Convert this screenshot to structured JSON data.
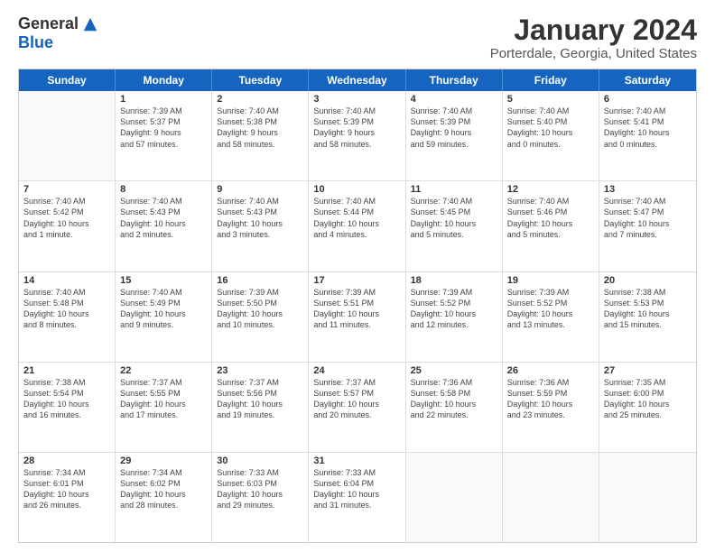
{
  "logo": {
    "general": "General",
    "blue": "Blue"
  },
  "title": "January 2024",
  "location": "Porterdale, Georgia, United States",
  "weekdays": [
    "Sunday",
    "Monday",
    "Tuesday",
    "Wednesday",
    "Thursday",
    "Friday",
    "Saturday"
  ],
  "rows": [
    [
      {
        "day": "",
        "lines": [],
        "empty": true
      },
      {
        "day": "1",
        "lines": [
          "Sunrise: 7:39 AM",
          "Sunset: 5:37 PM",
          "Daylight: 9 hours",
          "and 57 minutes."
        ]
      },
      {
        "day": "2",
        "lines": [
          "Sunrise: 7:40 AM",
          "Sunset: 5:38 PM",
          "Daylight: 9 hours",
          "and 58 minutes."
        ]
      },
      {
        "day": "3",
        "lines": [
          "Sunrise: 7:40 AM",
          "Sunset: 5:39 PM",
          "Daylight: 9 hours",
          "and 58 minutes."
        ]
      },
      {
        "day": "4",
        "lines": [
          "Sunrise: 7:40 AM",
          "Sunset: 5:39 PM",
          "Daylight: 9 hours",
          "and 59 minutes."
        ]
      },
      {
        "day": "5",
        "lines": [
          "Sunrise: 7:40 AM",
          "Sunset: 5:40 PM",
          "Daylight: 10 hours",
          "and 0 minutes."
        ]
      },
      {
        "day": "6",
        "lines": [
          "Sunrise: 7:40 AM",
          "Sunset: 5:41 PM",
          "Daylight: 10 hours",
          "and 0 minutes."
        ]
      }
    ],
    [
      {
        "day": "7",
        "lines": [
          "Sunrise: 7:40 AM",
          "Sunset: 5:42 PM",
          "Daylight: 10 hours",
          "and 1 minute."
        ]
      },
      {
        "day": "8",
        "lines": [
          "Sunrise: 7:40 AM",
          "Sunset: 5:43 PM",
          "Daylight: 10 hours",
          "and 2 minutes."
        ]
      },
      {
        "day": "9",
        "lines": [
          "Sunrise: 7:40 AM",
          "Sunset: 5:43 PM",
          "Daylight: 10 hours",
          "and 3 minutes."
        ]
      },
      {
        "day": "10",
        "lines": [
          "Sunrise: 7:40 AM",
          "Sunset: 5:44 PM",
          "Daylight: 10 hours",
          "and 4 minutes."
        ]
      },
      {
        "day": "11",
        "lines": [
          "Sunrise: 7:40 AM",
          "Sunset: 5:45 PM",
          "Daylight: 10 hours",
          "and 5 minutes."
        ]
      },
      {
        "day": "12",
        "lines": [
          "Sunrise: 7:40 AM",
          "Sunset: 5:46 PM",
          "Daylight: 10 hours",
          "and 5 minutes."
        ]
      },
      {
        "day": "13",
        "lines": [
          "Sunrise: 7:40 AM",
          "Sunset: 5:47 PM",
          "Daylight: 10 hours",
          "and 7 minutes."
        ]
      }
    ],
    [
      {
        "day": "14",
        "lines": [
          "Sunrise: 7:40 AM",
          "Sunset: 5:48 PM",
          "Daylight: 10 hours",
          "and 8 minutes."
        ]
      },
      {
        "day": "15",
        "lines": [
          "Sunrise: 7:40 AM",
          "Sunset: 5:49 PM",
          "Daylight: 10 hours",
          "and 9 minutes."
        ]
      },
      {
        "day": "16",
        "lines": [
          "Sunrise: 7:39 AM",
          "Sunset: 5:50 PM",
          "Daylight: 10 hours",
          "and 10 minutes."
        ]
      },
      {
        "day": "17",
        "lines": [
          "Sunrise: 7:39 AM",
          "Sunset: 5:51 PM",
          "Daylight: 10 hours",
          "and 11 minutes."
        ]
      },
      {
        "day": "18",
        "lines": [
          "Sunrise: 7:39 AM",
          "Sunset: 5:52 PM",
          "Daylight: 10 hours",
          "and 12 minutes."
        ]
      },
      {
        "day": "19",
        "lines": [
          "Sunrise: 7:39 AM",
          "Sunset: 5:52 PM",
          "Daylight: 10 hours",
          "and 13 minutes."
        ]
      },
      {
        "day": "20",
        "lines": [
          "Sunrise: 7:38 AM",
          "Sunset: 5:53 PM",
          "Daylight: 10 hours",
          "and 15 minutes."
        ]
      }
    ],
    [
      {
        "day": "21",
        "lines": [
          "Sunrise: 7:38 AM",
          "Sunset: 5:54 PM",
          "Daylight: 10 hours",
          "and 16 minutes."
        ]
      },
      {
        "day": "22",
        "lines": [
          "Sunrise: 7:37 AM",
          "Sunset: 5:55 PM",
          "Daylight: 10 hours",
          "and 17 minutes."
        ]
      },
      {
        "day": "23",
        "lines": [
          "Sunrise: 7:37 AM",
          "Sunset: 5:56 PM",
          "Daylight: 10 hours",
          "and 19 minutes."
        ]
      },
      {
        "day": "24",
        "lines": [
          "Sunrise: 7:37 AM",
          "Sunset: 5:57 PM",
          "Daylight: 10 hours",
          "and 20 minutes."
        ]
      },
      {
        "day": "25",
        "lines": [
          "Sunrise: 7:36 AM",
          "Sunset: 5:58 PM",
          "Daylight: 10 hours",
          "and 22 minutes."
        ]
      },
      {
        "day": "26",
        "lines": [
          "Sunrise: 7:36 AM",
          "Sunset: 5:59 PM",
          "Daylight: 10 hours",
          "and 23 minutes."
        ]
      },
      {
        "day": "27",
        "lines": [
          "Sunrise: 7:35 AM",
          "Sunset: 6:00 PM",
          "Daylight: 10 hours",
          "and 25 minutes."
        ]
      }
    ],
    [
      {
        "day": "28",
        "lines": [
          "Sunrise: 7:34 AM",
          "Sunset: 6:01 PM",
          "Daylight: 10 hours",
          "and 26 minutes."
        ]
      },
      {
        "day": "29",
        "lines": [
          "Sunrise: 7:34 AM",
          "Sunset: 6:02 PM",
          "Daylight: 10 hours",
          "and 28 minutes."
        ]
      },
      {
        "day": "30",
        "lines": [
          "Sunrise: 7:33 AM",
          "Sunset: 6:03 PM",
          "Daylight: 10 hours",
          "and 29 minutes."
        ]
      },
      {
        "day": "31",
        "lines": [
          "Sunrise: 7:33 AM",
          "Sunset: 6:04 PM",
          "Daylight: 10 hours",
          "and 31 minutes."
        ]
      },
      {
        "day": "",
        "lines": [],
        "empty": true
      },
      {
        "day": "",
        "lines": [],
        "empty": true
      },
      {
        "day": "",
        "lines": [],
        "empty": true
      }
    ]
  ]
}
